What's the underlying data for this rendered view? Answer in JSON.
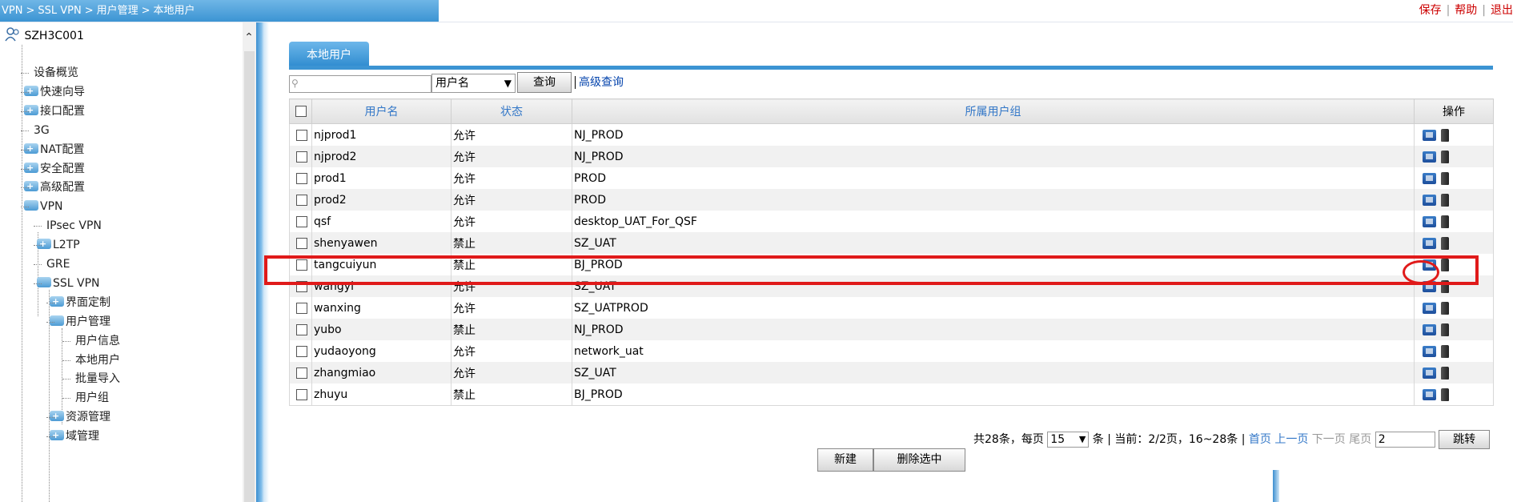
{
  "breadcrumb": [
    "VPN",
    "SSL VPN",
    "用户管理",
    "本地用户"
  ],
  "toplinks": {
    "save": "保存",
    "help": "帮助",
    "logout": "退出"
  },
  "sidebar": {
    "root": "SZH3C001",
    "items": [
      {
        "label": "设备概览",
        "level": 1,
        "folder": false
      },
      {
        "label": "快速向导",
        "level": 1,
        "folder": true
      },
      {
        "label": "接口配置",
        "level": 1,
        "folder": true
      },
      {
        "label": "3G",
        "level": 1,
        "folder": false
      },
      {
        "label": "NAT配置",
        "level": 1,
        "folder": true
      },
      {
        "label": "安全配置",
        "level": 1,
        "folder": true
      },
      {
        "label": "高级配置",
        "level": 1,
        "folder": true
      },
      {
        "label": "VPN",
        "level": 1,
        "folder": true,
        "open": true
      },
      {
        "label": "IPsec VPN",
        "level": 2,
        "folder": false
      },
      {
        "label": "L2TP",
        "level": 2,
        "folder": true
      },
      {
        "label": "GRE",
        "level": 2,
        "folder": false
      },
      {
        "label": "SSL VPN",
        "level": 2,
        "folder": true,
        "open": true
      },
      {
        "label": "界面定制",
        "level": 3,
        "folder": true
      },
      {
        "label": "用户管理",
        "level": 3,
        "folder": true,
        "open": true
      },
      {
        "label": "用户信息",
        "level": 4,
        "folder": false
      },
      {
        "label": "本地用户",
        "level": 4,
        "folder": false
      },
      {
        "label": "批量导入",
        "level": 4,
        "folder": false
      },
      {
        "label": "用户组",
        "level": 4,
        "folder": false
      },
      {
        "label": "资源管理",
        "level": 3,
        "folder": true
      },
      {
        "label": "域管理",
        "level": 3,
        "folder": true
      }
    ]
  },
  "tab": "本地用户",
  "search": {
    "value": "",
    "field": "用户名",
    "query_label": "查询",
    "advanced_label": "高级查询"
  },
  "table": {
    "headers": [
      "用户名",
      "状态",
      "所属用户组",
      "操作"
    ],
    "rows": [
      {
        "user": "njprod1",
        "status": "允许",
        "group": "NJ_PROD"
      },
      {
        "user": "njprod2",
        "status": "允许",
        "group": "NJ_PROD"
      },
      {
        "user": "prod1",
        "status": "允许",
        "group": "PROD"
      },
      {
        "user": "prod2",
        "status": "允许",
        "group": "PROD"
      },
      {
        "user": "qsf",
        "status": "允许",
        "group": "desktop_UAT_For_QSF"
      },
      {
        "user": "shenyawen",
        "status": "禁止",
        "group": "SZ_UAT"
      },
      {
        "user": "tangcuiyun",
        "status": "禁止",
        "group": "BJ_PROD"
      },
      {
        "user": "wangyi",
        "status": "允许",
        "group": "SZ_UAT"
      },
      {
        "user": "wanxing",
        "status": "允许",
        "group": "SZ_UATPROD"
      },
      {
        "user": "yubo",
        "status": "禁止",
        "group": "NJ_PROD"
      },
      {
        "user": "yudaoyong",
        "status": "允许",
        "group": "network_uat"
      },
      {
        "user": "zhangmiao",
        "status": "允许",
        "group": "SZ_UAT"
      },
      {
        "user": "zhuyu",
        "status": "禁止",
        "group": "BJ_PROD"
      }
    ]
  },
  "pager": {
    "total_text": "共28条，每页",
    "per_page": "15",
    "unit": "条",
    "current_text": "当前：2/2页，16~28条",
    "first": "首页",
    "prev": "上一页",
    "next": "下一页",
    "last": "尾页",
    "page_value": "2",
    "jump": "跳转"
  },
  "actions": {
    "new": "新建",
    "delete_selected": "删除选中"
  },
  "icons": {
    "edit": "edit-user-icon",
    "delete": "trash-icon",
    "user": "user-icon"
  },
  "colors": {
    "accent": "#3c94d3",
    "highlight": "#e01a1a",
    "link": "#3478c8"
  }
}
